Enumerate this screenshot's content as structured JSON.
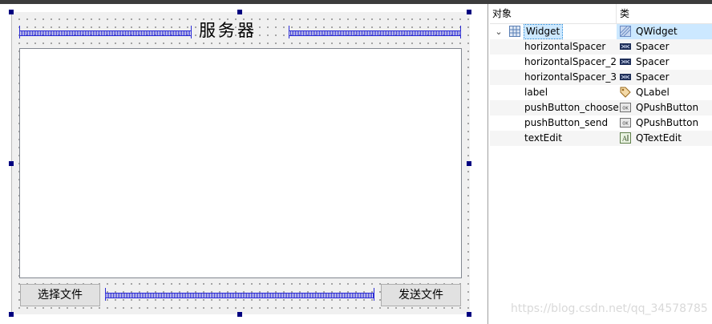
{
  "form": {
    "label_text": "服务器",
    "button_choose_label": "选择文件",
    "button_send_label": "发送文件"
  },
  "inspector": {
    "column_object": "对象",
    "column_class": "类",
    "rows": [
      {
        "name": "Widget",
        "cls": "QWidget",
        "icon": "widget-grid-icon",
        "expanded": true,
        "selected": true
      },
      {
        "name": "horizontalSpacer",
        "cls": "Spacer",
        "icon": "spacer-icon"
      },
      {
        "name": "horizontalSpacer_2",
        "cls": "Spacer",
        "icon": "spacer-icon"
      },
      {
        "name": "horizontalSpacer_3",
        "cls": "Spacer",
        "icon": "spacer-icon"
      },
      {
        "name": "label",
        "cls": "QLabel",
        "icon": "label-tag-icon"
      },
      {
        "name": "pushButton_choose",
        "cls": "QPushButton",
        "icon": "pushbutton-icon"
      },
      {
        "name": "pushButton_send",
        "cls": "QPushButton",
        "icon": "pushbutton-icon"
      },
      {
        "name": "textEdit",
        "cls": "QTextEdit",
        "icon": "textedit-icon"
      }
    ]
  },
  "watermark": "https://blog.csdn.net/qq_34578785"
}
